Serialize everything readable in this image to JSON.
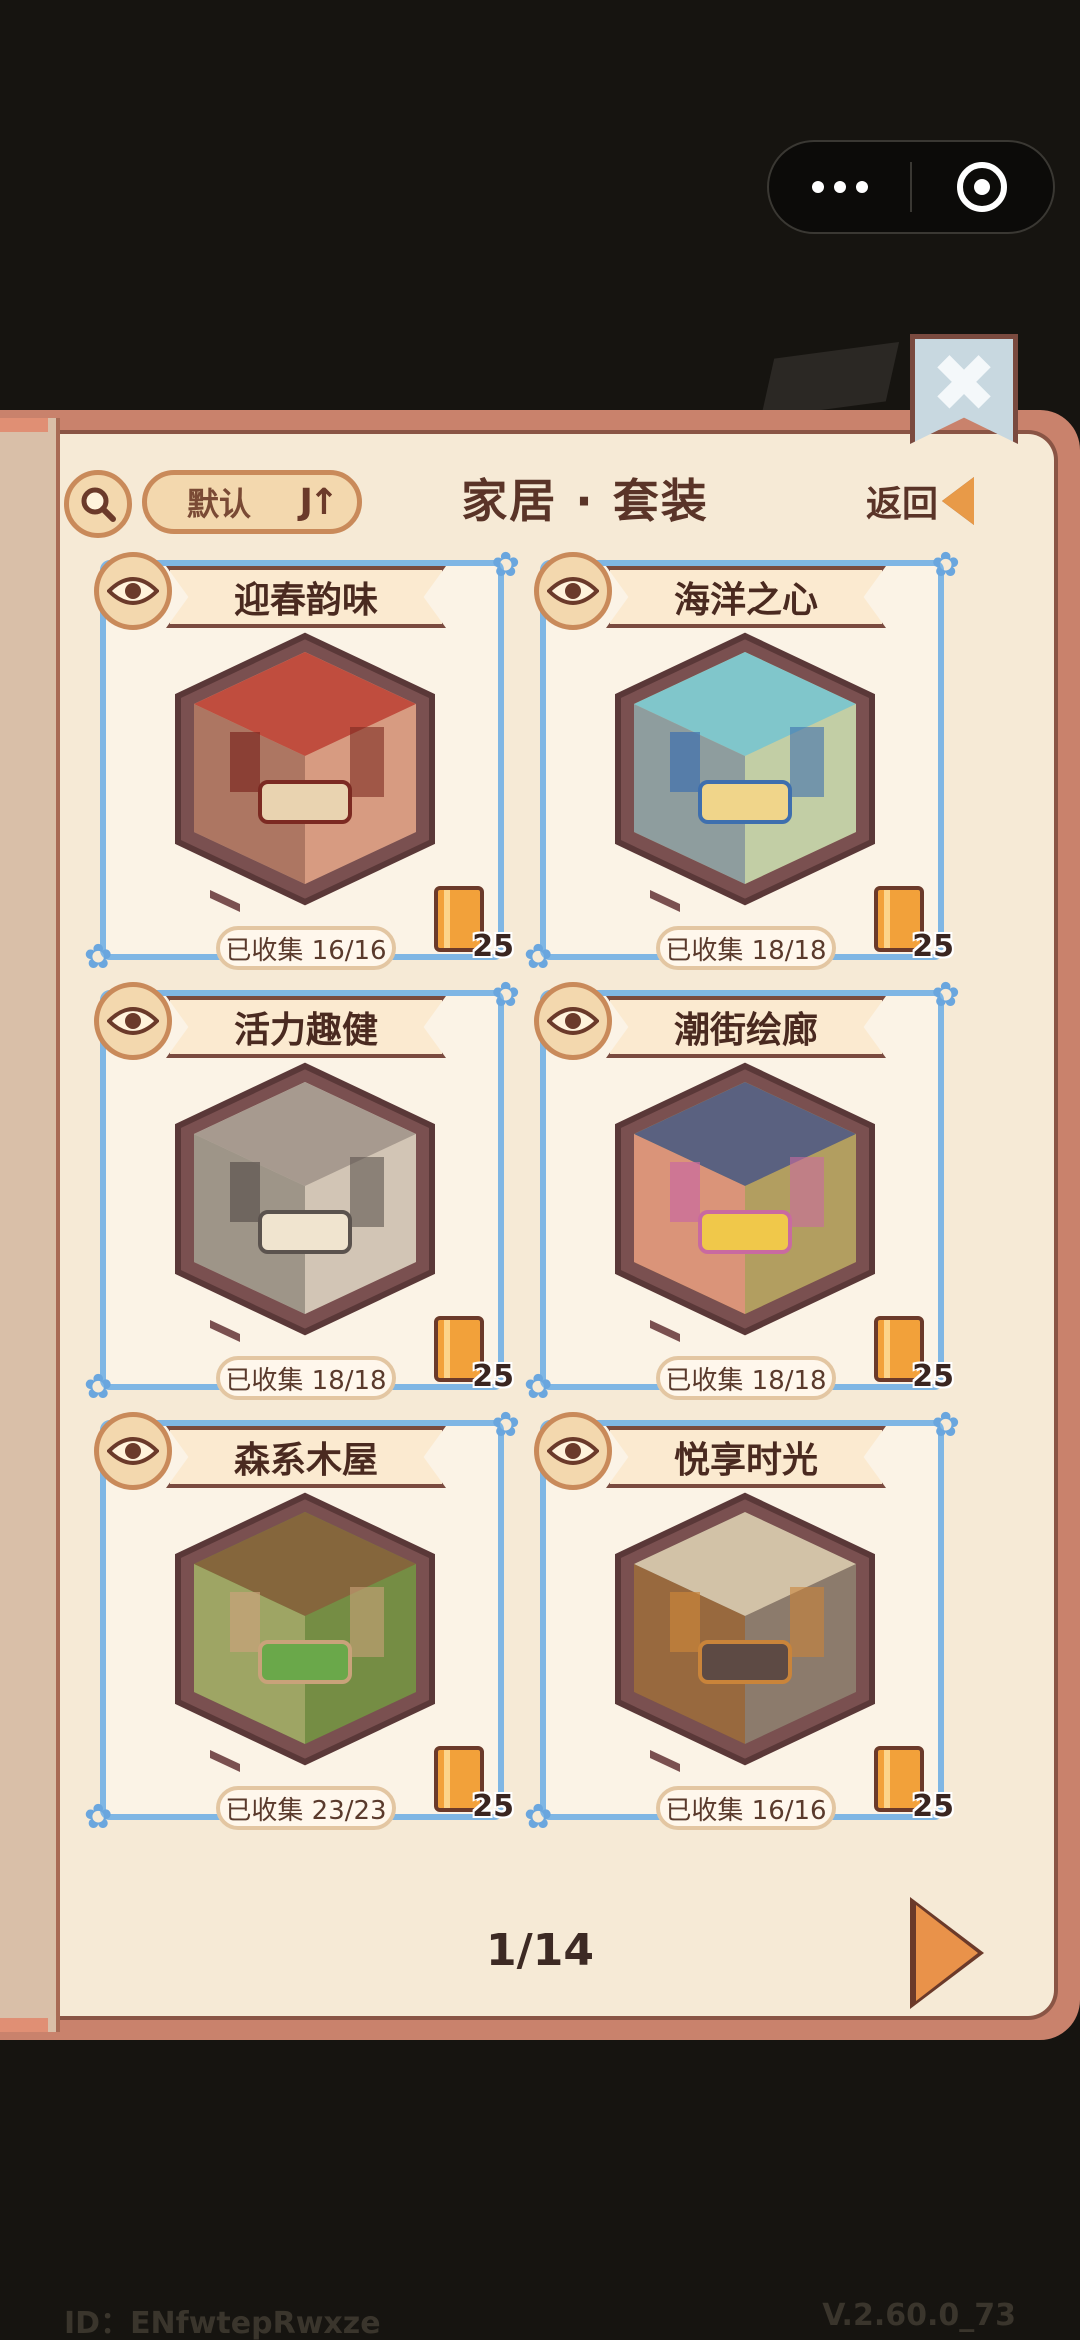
{
  "capsule": {
    "more_icon": "more-dots-icon",
    "close_icon": "target-icon"
  },
  "header": {
    "sort_label": "默认",
    "sort_icon": "J↑",
    "title": "家居 · 套装",
    "back_label": "返回"
  },
  "bookmark": {
    "glyph": "✖"
  },
  "sets": [
    {
      "name": "迎春韵味",
      "collected": "已收集 16/16",
      "reward": "25",
      "palette": [
        "#b8352a",
        "#e9d3b0",
        "#7c2a22"
      ]
    },
    {
      "name": "海洋之心",
      "collected": "已收集 18/18",
      "reward": "25",
      "palette": [
        "#6cc3d6",
        "#f0d58a",
        "#3e6fae"
      ]
    },
    {
      "name": "活力趣健",
      "collected": "已收集 18/18",
      "reward": "25",
      "palette": [
        "#9a8d84",
        "#f0e4cf",
        "#5b534e"
      ]
    },
    {
      "name": "潮街绘廊",
      "collected": "已收集 18/18",
      "reward": "25",
      "palette": [
        "#3f4f8a",
        "#f0c84a",
        "#c96aa0"
      ]
    },
    {
      "name": "森系木屋",
      "collected": "已收集 23/23",
      "reward": "25",
      "palette": [
        "#8a5b3a",
        "#6aa84a",
        "#c9a27a"
      ]
    },
    {
      "name": "悦享时光",
      "collected": "已收集 16/16",
      "reward": "25",
      "palette": [
        "#e6d7b8",
        "#5d4a44",
        "#c9843a"
      ]
    }
  ],
  "pager": {
    "text": "1/14"
  },
  "footer": {
    "user_id": "ID：ENfwtepRwxze",
    "version": "V.2.60.0_73"
  }
}
